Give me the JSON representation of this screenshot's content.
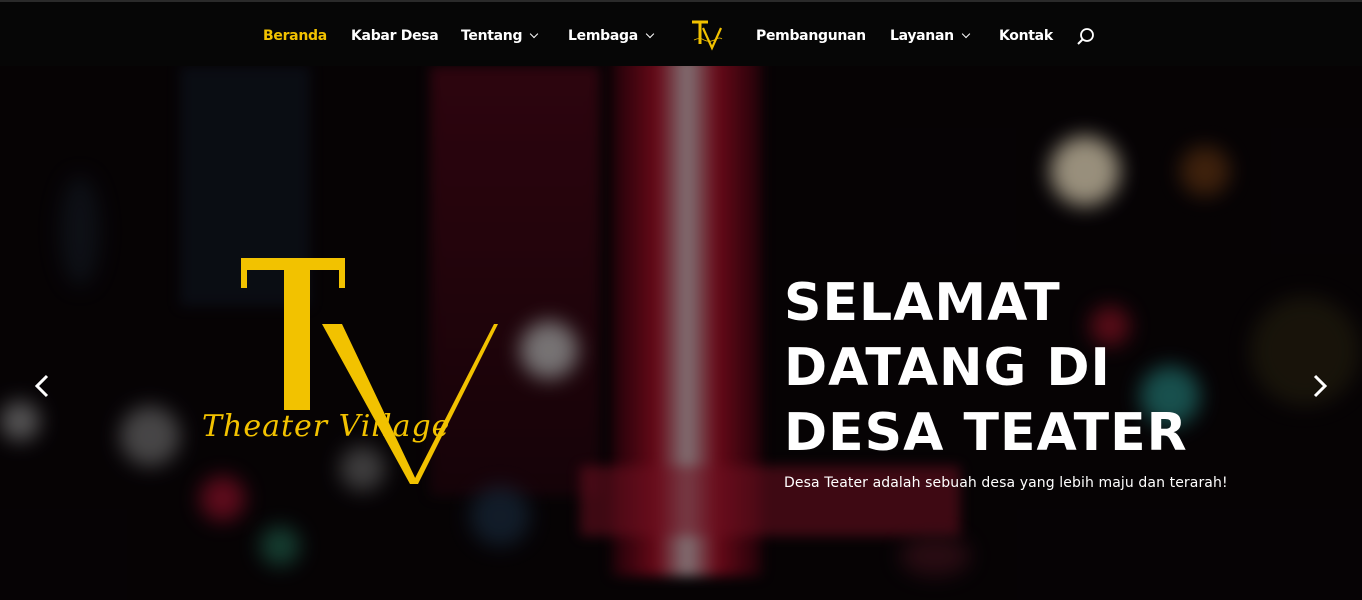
{
  "nav": {
    "items": [
      {
        "label": "Beranda",
        "active": true
      },
      {
        "label": "Kabar Desa"
      },
      {
        "label": "Tentang",
        "dropdown": true
      },
      {
        "label": "Lembaga",
        "dropdown": true
      },
      {
        "label": "Pembangunan"
      },
      {
        "label": "Layanan",
        "dropdown": true
      },
      {
        "label": "Kontak"
      }
    ],
    "search_icon": "search-icon",
    "logo_text": "TV",
    "logo_caption": "Theater Village"
  },
  "hero": {
    "logo_letters": "TV",
    "logo_script": "Theater Village",
    "title": "SELAMAT\nDATANG DI\nDESA TEATER",
    "subtitle": "Desa Teater adalah sebuah desa yang lebih maju dan terarah!",
    "prev_icon": "chevron-left-icon",
    "next_icon": "chevron-right-icon"
  },
  "colors": {
    "accent": "#f2c200",
    "nav_bg": "#060606",
    "text": "#ffffff"
  }
}
